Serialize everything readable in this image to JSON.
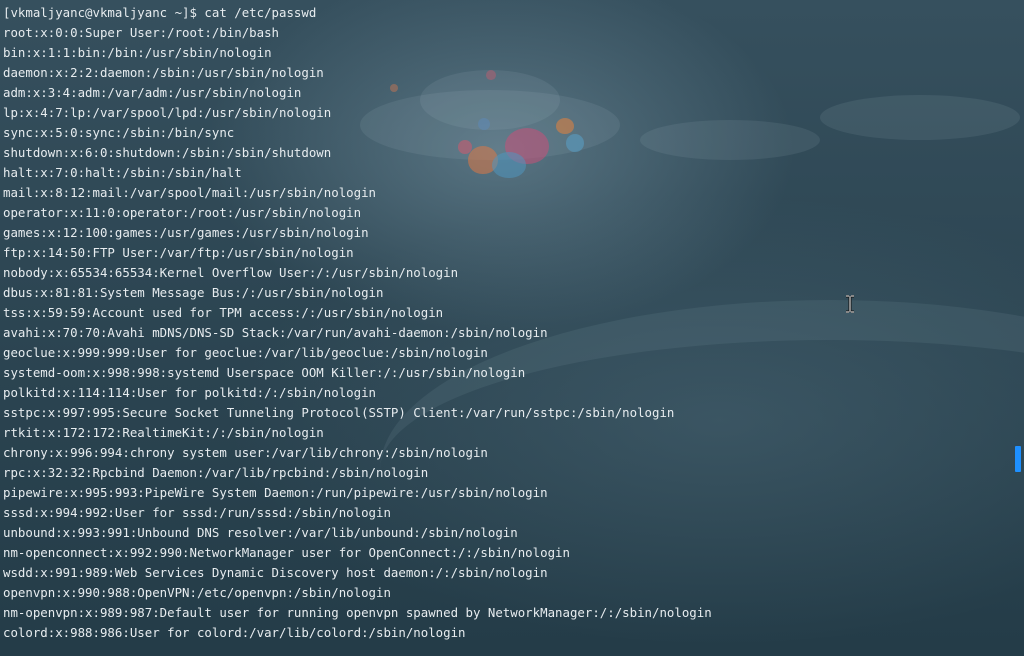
{
  "terminal": {
    "prompt": "[vkmaljyanc@vkmaljyanc ~]$ cat /etc/passwd",
    "output": [
      "root:x:0:0:Super User:/root:/bin/bash",
      "bin:x:1:1:bin:/bin:/usr/sbin/nologin",
      "daemon:x:2:2:daemon:/sbin:/usr/sbin/nologin",
      "adm:x:3:4:adm:/var/adm:/usr/sbin/nologin",
      "lp:x:4:7:lp:/var/spool/lpd:/usr/sbin/nologin",
      "sync:x:5:0:sync:/sbin:/bin/sync",
      "shutdown:x:6:0:shutdown:/sbin:/sbin/shutdown",
      "halt:x:7:0:halt:/sbin:/sbin/halt",
      "mail:x:8:12:mail:/var/spool/mail:/usr/sbin/nologin",
      "operator:x:11:0:operator:/root:/usr/sbin/nologin",
      "games:x:12:100:games:/usr/games:/usr/sbin/nologin",
      "ftp:x:14:50:FTP User:/var/ftp:/usr/sbin/nologin",
      "nobody:x:65534:65534:Kernel Overflow User:/:/usr/sbin/nologin",
      "dbus:x:81:81:System Message Bus:/:/usr/sbin/nologin",
      "tss:x:59:59:Account used for TPM access:/:/usr/sbin/nologin",
      "avahi:x:70:70:Avahi mDNS/DNS-SD Stack:/var/run/avahi-daemon:/sbin/nologin",
      "geoclue:x:999:999:User for geoclue:/var/lib/geoclue:/sbin/nologin",
      "systemd-oom:x:998:998:systemd Userspace OOM Killer:/:/usr/sbin/nologin",
      "polkitd:x:114:114:User for polkitd:/:/sbin/nologin",
      "sstpc:x:997:995:Secure Socket Tunneling Protocol(SSTP) Client:/var/run/sstpc:/sbin/nologin",
      "rtkit:x:172:172:RealtimeKit:/:/sbin/nologin",
      "chrony:x:996:994:chrony system user:/var/lib/chrony:/sbin/nologin",
      "rpc:x:32:32:Rpcbind Daemon:/var/lib/rpcbind:/sbin/nologin",
      "pipewire:x:995:993:PipeWire System Daemon:/run/pipewire:/usr/sbin/nologin",
      "sssd:x:994:992:User for sssd:/run/sssd:/sbin/nologin",
      "unbound:x:993:991:Unbound DNS resolver:/var/lib/unbound:/sbin/nologin",
      "nm-openconnect:x:992:990:NetworkManager user for OpenConnect:/:/sbin/nologin",
      "wsdd:x:991:989:Web Services Dynamic Discovery host daemon:/:/sbin/nologin",
      "openvpn:x:990:988:OpenVPN:/etc/openvpn:/sbin/nologin",
      "nm-openvpn:x:989:987:Default user for running openvpn spawned by NetworkManager:/:/sbin/nologin",
      "colord:x:988:986:User for colord:/var/lib/colord:/sbin/nologin"
    ]
  },
  "colors": {
    "text": "#e7ecef",
    "scroll_thumb": "#1e90ff"
  },
  "icons": {
    "cursor": "text-cursor-icon"
  }
}
